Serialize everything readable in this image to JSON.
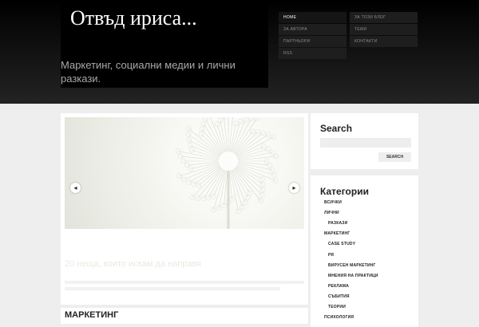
{
  "site": {
    "title": "Отвъд ириса...",
    "tagline": "Маркетинг, социални медии и лични разкази."
  },
  "nav": {
    "left": [
      "HOME",
      "ЗА АВТОРА",
      "ПАРТНЬОРИ",
      "RSS"
    ],
    "right": [
      "ЗА ТОЗИ БЛОГ",
      "ТЕМИ",
      "КОНТАКТИ"
    ],
    "active": "HOME"
  },
  "slider": {
    "slide_title": "20 неща, които искам да направя",
    "prev_glyph": "◂",
    "next_glyph": "▸"
  },
  "section": {
    "heading": "МАРКЕТИНГ"
  },
  "search": {
    "title": "Search",
    "placeholder": "",
    "button": "SEARCH"
  },
  "categories": {
    "title": "Категории",
    "items": [
      {
        "label": "ВСИЧКИ",
        "level": 0
      },
      {
        "label": "ЛИЧНИ",
        "level": 0
      },
      {
        "label": "РАЗКАЗИ",
        "level": 1
      },
      {
        "label": "МАРКЕТИНГ",
        "level": 0
      },
      {
        "label": "CASE STUDY",
        "level": 1
      },
      {
        "label": "PR",
        "level": 1
      },
      {
        "label": "ВИРУСЕН МАРКЕТИНГ",
        "level": 1
      },
      {
        "label": "МНЕНИЯ НА ПРАКТИЦИ",
        "level": 1
      },
      {
        "label": "РЕКЛАМА",
        "level": 1
      },
      {
        "label": "СЪБИТИЯ",
        "level": 1
      },
      {
        "label": "ТЕОРИИ",
        "level": 1
      },
      {
        "label": "ПСИХОЛОГИЯ",
        "level": 0
      }
    ]
  },
  "colors": {
    "header_bg": "#000000",
    "page_bg": "#eeeeee",
    "menu_bg": "#1e1e1e",
    "text": "#222222"
  }
}
